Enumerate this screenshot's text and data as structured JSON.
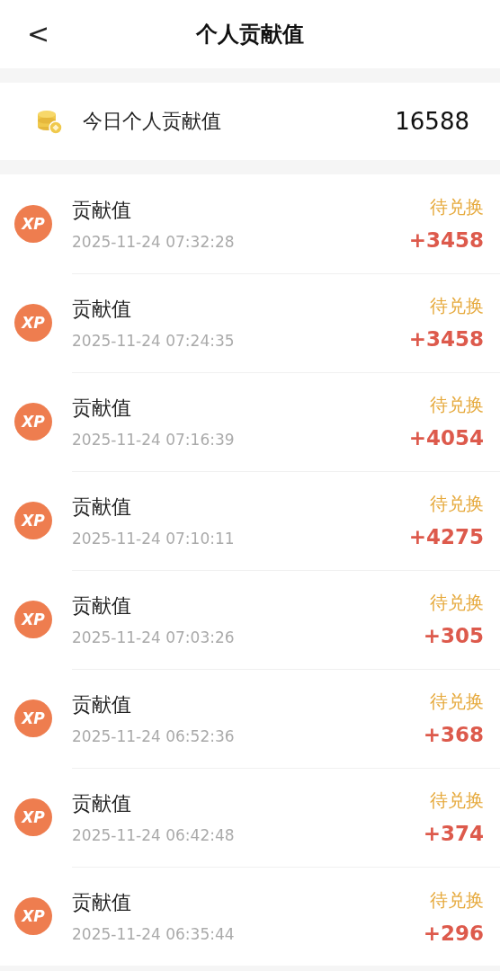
{
  "header": {
    "back": "<",
    "title": "个人贡献值"
  },
  "summary": {
    "label": "今日个人贡献值",
    "value": "16588"
  },
  "records": [
    {
      "badge": "XP",
      "title": "贡献值",
      "time": "2025-11-24 07:32:28",
      "status": "待兑换",
      "amount": "+3458"
    },
    {
      "badge": "XP",
      "title": "贡献值",
      "time": "2025-11-24 07:24:35",
      "status": "待兑换",
      "amount": "+3458"
    },
    {
      "badge": "XP",
      "title": "贡献值",
      "time": "2025-11-24 07:16:39",
      "status": "待兑换",
      "amount": "+4054"
    },
    {
      "badge": "XP",
      "title": "贡献值",
      "time": "2025-11-24 07:10:11",
      "status": "待兑换",
      "amount": "+4275"
    },
    {
      "badge": "XP",
      "title": "贡献值",
      "time": "2025-11-24 07:03:26",
      "status": "待兑换",
      "amount": "+305"
    },
    {
      "badge": "XP",
      "title": "贡献值",
      "time": "2025-11-24 06:52:36",
      "status": "待兑换",
      "amount": "+368"
    },
    {
      "badge": "XP",
      "title": "贡献值",
      "time": "2025-11-24 06:42:48",
      "status": "待兑换",
      "amount": "+374"
    },
    {
      "badge": "XP",
      "title": "贡献值",
      "time": "2025-11-24 06:35:44",
      "status": "待兑换",
      "amount": "+296"
    }
  ]
}
